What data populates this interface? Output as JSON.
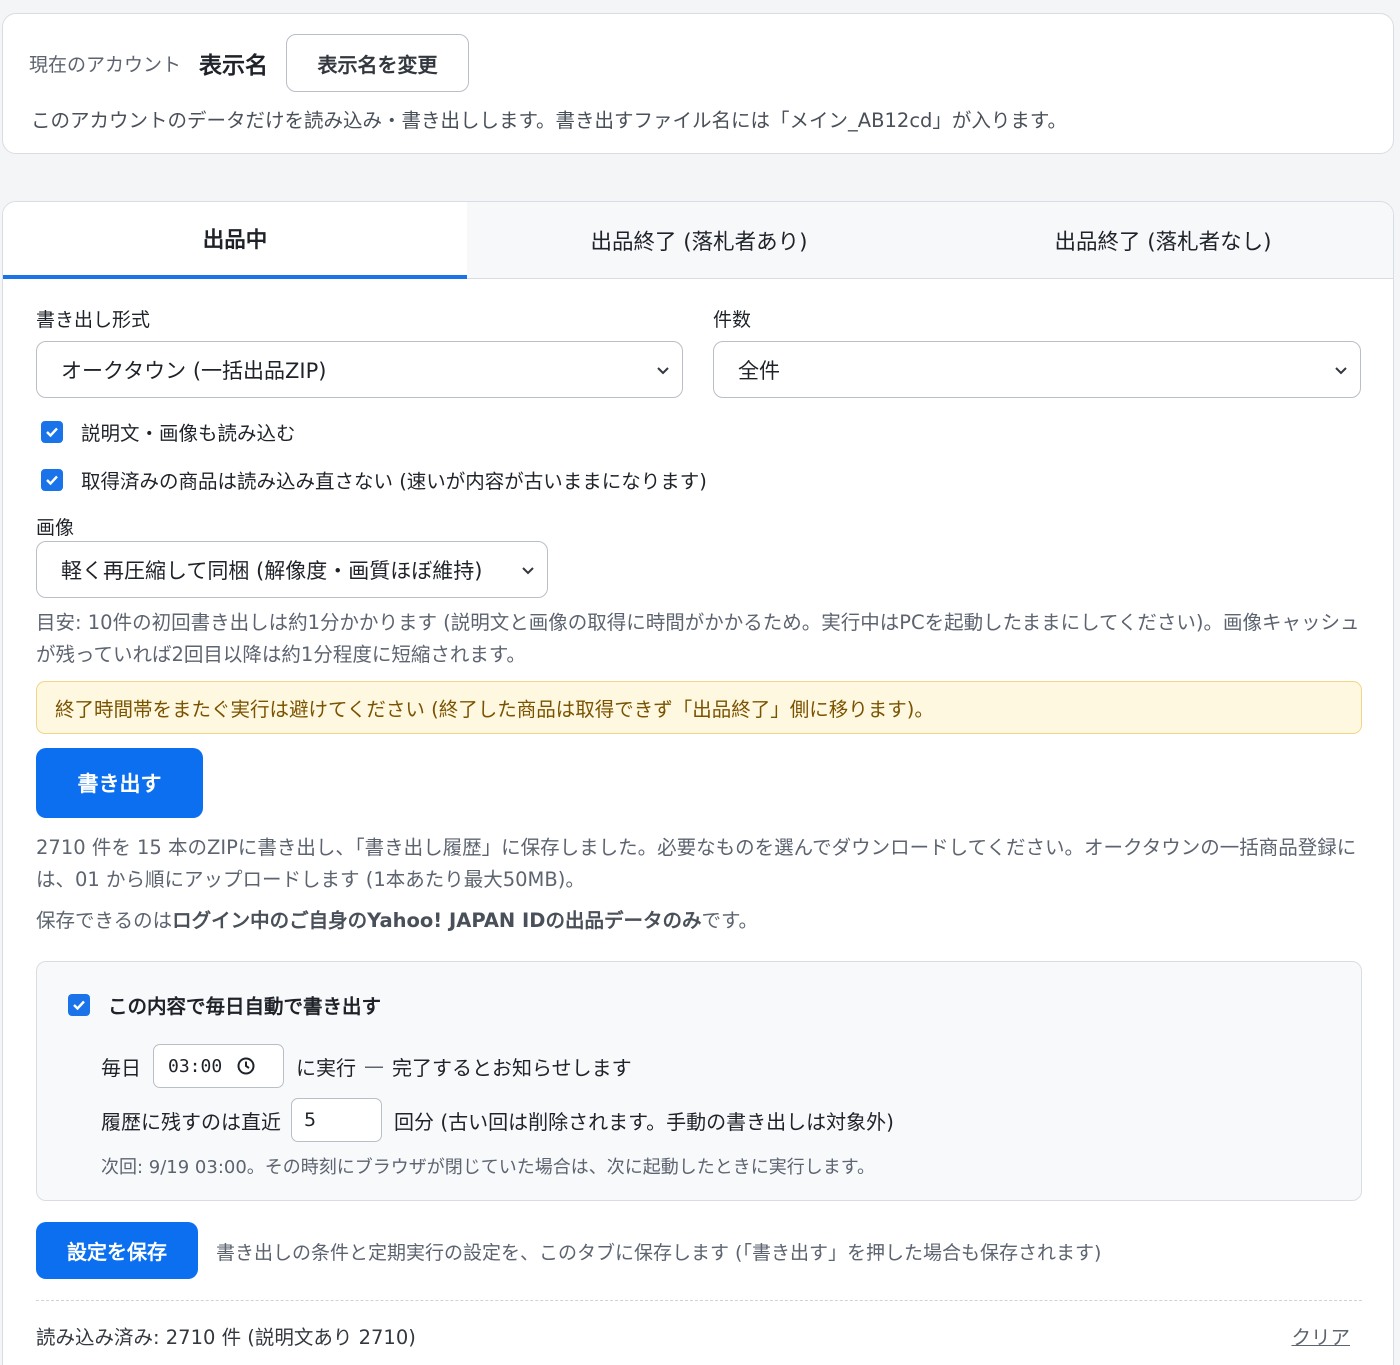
{
  "account": {
    "label": "現在のアカウント",
    "name": "表示名",
    "change_button": "表示名を変更",
    "note": "このアカウントのデータだけを読み込み・書き出しします。書き出すファイル名には「メイン_AB12cd」が入ります。"
  },
  "tabs": [
    {
      "label": "出品中",
      "active": true
    },
    {
      "label": "出品終了 (落札者あり)",
      "active": false
    },
    {
      "label": "出品終了 (落札者なし)",
      "active": false
    }
  ],
  "form": {
    "format_label": "書き出し形式",
    "format_value": "オークタウン (一括出品ZIP)",
    "count_label": "件数",
    "count_value": "全件",
    "checkbox_desc": "説明文・画像も読み込む",
    "checkbox_skip": "取得済みの商品は読み込み直さない (速いが内容が古いままになります)",
    "image_label": "画像",
    "image_value": "軽く再圧縮して同梱 (解像度・画質ほぼ維持)",
    "hint": "目安: 10件の初回書き出しは約1分かかります (説明文と画像の取得に時間がかかるため。実行中はPCを起動したままにしてください)。画像キャッシュが残っていれば2回目以降は約1分程度に短縮されます。",
    "warning": "終了時間帯をまたぐ実行は避けてください (終了した商品は取得できず「出品終了」側に移ります)。",
    "export_button": "書き出す",
    "result": "2710 件を 15 本のZIPに書き出し、「書き出し履歴」に保存しました。必要なものを選んでダウンロードしてください。オークタウンの一括商品登録には、01 から順にアップロードします (1本あたり最大50MB)。",
    "save_note_pre": "保存できるのは",
    "save_note_bold": "ログイン中のご自身のYahoo! JAPAN IDの出品データのみ",
    "save_note_post": "です。"
  },
  "auto": {
    "enabled_label": "この内容で毎日自動で書き出す",
    "daily_label": "毎日",
    "time_value": "03:00",
    "after_time": "に実行",
    "dash": "—",
    "notify_text": "完了するとお知らせします",
    "keep_label": "履歴に残すのは直近",
    "keep_value": "5",
    "keep_suffix": "回分 (古い回は削除されます。手動の書き出しは対象外)",
    "next_run": "次回: 9/19 03:00。その時刻にブラウザが閉じていた場合は、次に起動したときに実行します。"
  },
  "save": {
    "button": "設定を保存",
    "note": "書き出しの条件と定期実行の設定を、このタブに保存します (「書き出す」を押した場合も保存されます)"
  },
  "footer": {
    "loaded": "読み込み済み: 2710 件 (説明文あり 2710)",
    "clear": "クリア"
  },
  "colors": {
    "accent": "#0b6ff0",
    "tab_underline": "#1a73e8",
    "warning_bg": "#fff8e1",
    "warning_text": "#7a5300"
  }
}
